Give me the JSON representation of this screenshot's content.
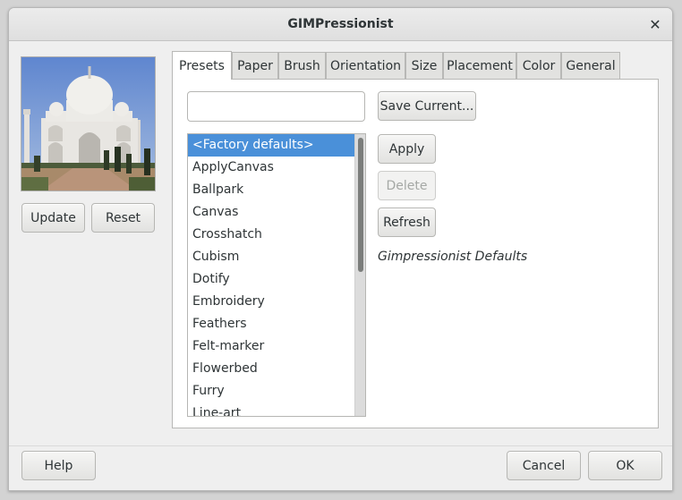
{
  "window": {
    "title": "GIMPressionist",
    "close_icon": "close-icon"
  },
  "preview": {
    "image": "taj-mahal-preview",
    "update_label": "Update",
    "reset_label": "Reset"
  },
  "tabs": [
    {
      "label": "Presets",
      "active": true
    },
    {
      "label": "Paper",
      "active": false
    },
    {
      "label": "Brush",
      "active": false
    },
    {
      "label": "Orientation",
      "active": false
    },
    {
      "label": "Size",
      "active": false
    },
    {
      "label": "Placement",
      "active": false
    },
    {
      "label": "Color",
      "active": false
    },
    {
      "label": "General",
      "active": false
    }
  ],
  "presets": {
    "name_value": "",
    "save_current_label": "Save Current...",
    "apply_label": "Apply",
    "delete_label": "Delete",
    "refresh_label": "Refresh",
    "description": "Gimpressionist Defaults",
    "selected_index": 0,
    "items": [
      "<Factory defaults>",
      "ApplyCanvas",
      "Ballpark",
      "Canvas",
      "Crosshatch",
      "Cubism",
      "Dotify",
      "Embroidery",
      "Feathers",
      "Felt-marker",
      "Flowerbed",
      "Furry",
      "Line-art"
    ]
  },
  "footer": {
    "help_label": "Help",
    "cancel_label": "Cancel",
    "ok_label": "OK"
  },
  "colors": {
    "selection": "#4a90d9",
    "window_bg": "#efefef"
  }
}
